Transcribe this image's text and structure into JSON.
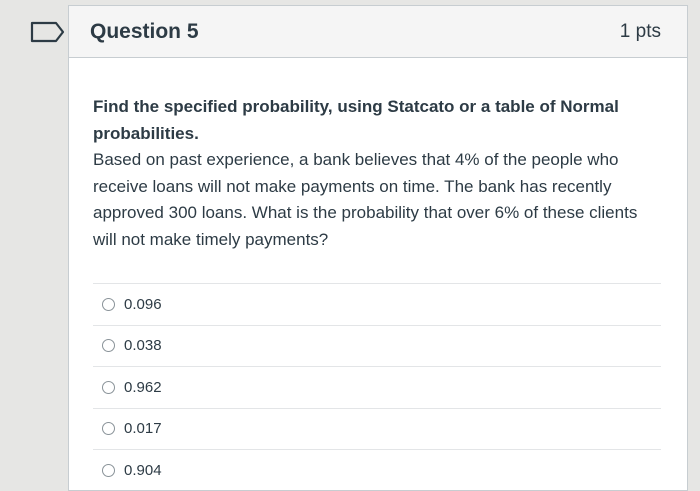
{
  "question": {
    "title": "Question 5",
    "points": "1 pts",
    "instruction": "Find the specified probability, using Statcato or a table of Normal probabilities.",
    "body": "Based on past experience, a bank believes that 4% of the people who receive loans will not make payments on time. The bank has recently approved 300 loans. What is the probability that over 6% of these clients will not make timely payments?"
  },
  "answers": [
    {
      "label": "0.096"
    },
    {
      "label": "0.038"
    },
    {
      "label": "0.962"
    },
    {
      "label": "0.017"
    },
    {
      "label": "0.904"
    }
  ],
  "colors": {
    "flag": "#2d3b45",
    "header_bg": "#f5f5f5",
    "text": "#2d3b45"
  }
}
